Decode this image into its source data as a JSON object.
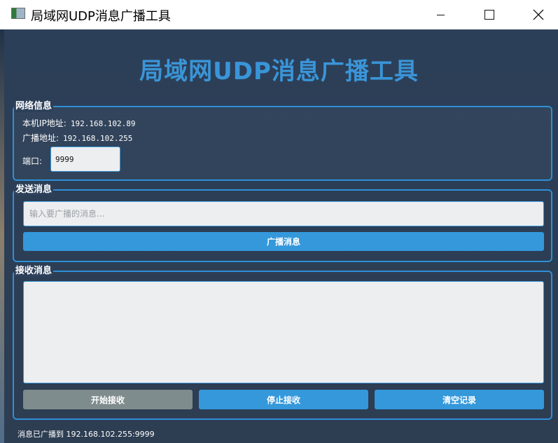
{
  "window": {
    "title": "局域网UDP消息广播工具"
  },
  "header": {
    "title": "局域网UDP消息广播工具"
  },
  "network_info": {
    "group_title": "网络信息",
    "local_ip_label": "本机IP地址:",
    "local_ip_value": "192.168.102.89",
    "broadcast_label": "广播地址:",
    "broadcast_value": "192.168.102.255",
    "port_label": "端口:",
    "port_value": "9999"
  },
  "send": {
    "group_title": "发送消息",
    "input_placeholder": "输入要广播的消息...",
    "input_value": "",
    "broadcast_button": "广播消息"
  },
  "receive": {
    "group_title": "接收消息",
    "log_text": "",
    "start_button": "开始接收",
    "stop_button": "停止接收",
    "clear_button": "清空记录"
  },
  "status": {
    "text": "消息已广播到 192.168.102.255:9999"
  },
  "colors": {
    "accent": "#3498db",
    "background": "#2c3e50",
    "disabled_button": "#7f8c8d"
  }
}
